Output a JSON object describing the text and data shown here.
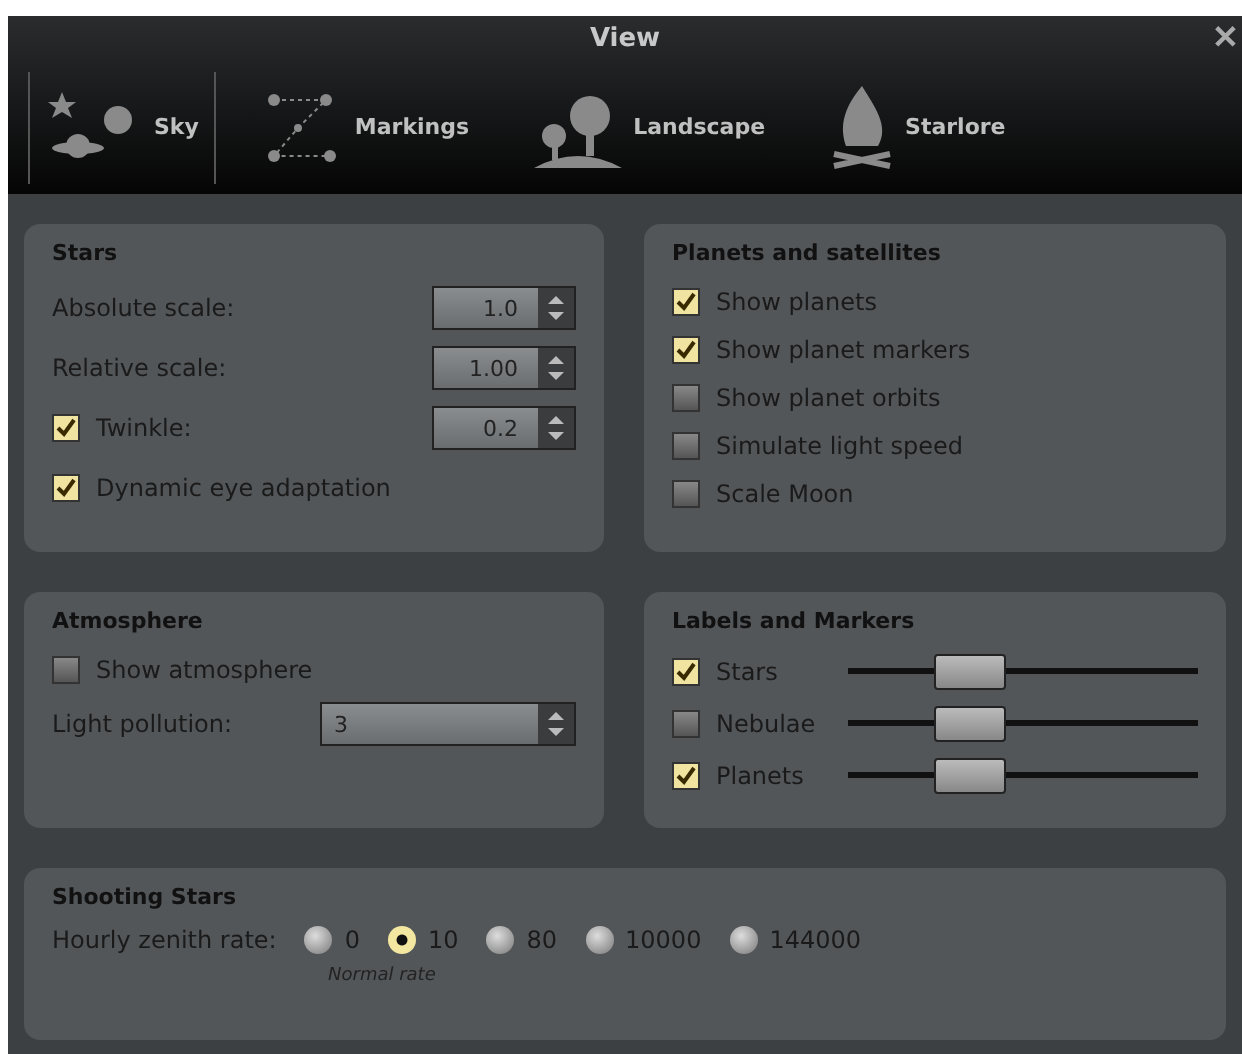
{
  "window": {
    "title": "View",
    "close": "✕"
  },
  "tabs": [
    {
      "label": "Sky",
      "kind": "sky",
      "selected": true
    },
    {
      "label": "Markings",
      "kind": "markings",
      "selected": false
    },
    {
      "label": "Landscape",
      "kind": "landscape",
      "selected": false
    },
    {
      "label": "Starlore",
      "kind": "starlore",
      "selected": false
    }
  ],
  "stars": {
    "title": "Stars",
    "rows": [
      {
        "kind": "spin",
        "label": "Absolute scale:",
        "value": "1.0"
      },
      {
        "kind": "spin",
        "label": "Relative scale:",
        "value": "1.00"
      },
      {
        "kind": "checkspin",
        "label": "Twinkle:",
        "checked": true,
        "value": "0.2"
      },
      {
        "kind": "check",
        "label": "Dynamic eye adaptation",
        "checked": true
      }
    ]
  },
  "planets": {
    "title": "Planets and satellites",
    "options": [
      {
        "label": "Show planets",
        "checked": true
      },
      {
        "label": "Show planet markers",
        "checked": true
      },
      {
        "label": "Show planet orbits",
        "checked": false
      },
      {
        "label": "Simulate light speed",
        "checked": false
      },
      {
        "label": "Scale Moon",
        "checked": false
      }
    ]
  },
  "atmosphere": {
    "title": "Atmosphere",
    "show": {
      "label": "Show atmosphere",
      "checked": false
    },
    "pollution": {
      "label": "Light pollution:",
      "value": "3"
    }
  },
  "labels": {
    "title": "Labels and Markers",
    "items": [
      {
        "label": "Stars",
        "checked": true,
        "level": 0.34
      },
      {
        "label": "Nebulae",
        "checked": false,
        "level": 0.34
      },
      {
        "label": "Planets",
        "checked": true,
        "level": 0.34
      }
    ]
  },
  "shooting": {
    "title": "Shooting Stars",
    "label": "Hourly zenith rate:",
    "rates": [
      {
        "label": "0",
        "selected": false
      },
      {
        "label": "10",
        "selected": true
      },
      {
        "label": "80",
        "selected": false
      },
      {
        "label": "10000",
        "selected": false
      },
      {
        "label": "144000",
        "selected": false
      }
    ],
    "note": "Normal rate"
  }
}
